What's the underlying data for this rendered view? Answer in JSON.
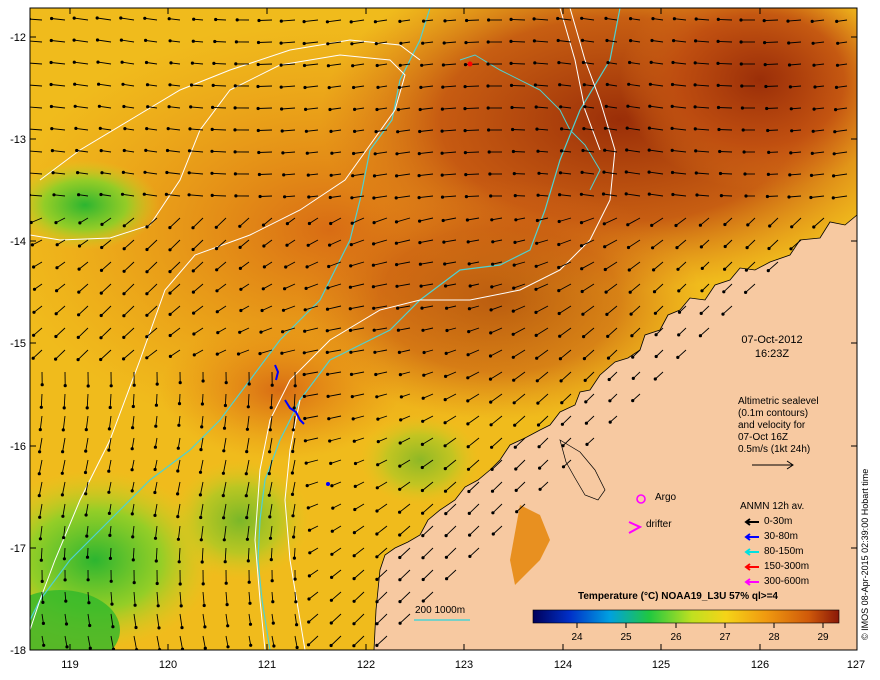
{
  "map": {
    "lon_ticks": [
      "119",
      "120",
      "121",
      "122",
      "123",
      "124",
      "125",
      "126",
      "127"
    ],
    "lat_ticks": [
      "-12",
      "-13",
      "-14",
      "-15",
      "-16",
      "-17",
      "-18"
    ],
    "land_color": "#f7c9a1",
    "ocean_colors": {
      "warm": "#b8420c",
      "mid": "#e58a12",
      "cool": "#f2c51c",
      "cold": "#32bb2a"
    },
    "contour_color": "#4fd2d2"
  },
  "annotations": {
    "date": "07-Oct-2012",
    "time": "16:23Z",
    "altimetry_lines": [
      "Altimetric sealevel",
      "(0.1m contours)",
      "and velocity for",
      "07-Oct 16Z",
      "0.5m/s (1kt 24h)"
    ],
    "argo": "Argo",
    "drifter": "drifter",
    "anmn_title": "ANMN 12h av.",
    "depth_legend": [
      {
        "label": "0-30m",
        "color": "#000000"
      },
      {
        "label": "30-80m",
        "color": "#0000ff"
      },
      {
        "label": "80-150m",
        "color": "#00e0e0"
      },
      {
        "label": "150-300m",
        "color": "#ff0000"
      },
      {
        "label": "300-600m",
        "color": "#ff00ff"
      }
    ],
    "bathy": "200  1000m",
    "credit": "© IMOS 08-Apr-2015 02:39:00 Hobart time"
  },
  "colorbar": {
    "title": "Temperature (°C) NOAA19_L3U 57% ql>=4",
    "ticks": [
      "24",
      "25",
      "26",
      "27",
      "28",
      "29"
    ],
    "range": [
      23.4,
      29.2
    ]
  }
}
